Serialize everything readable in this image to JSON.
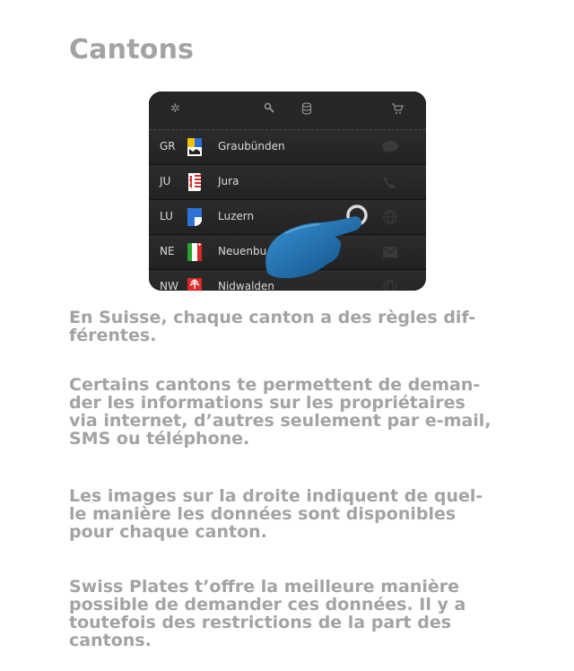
{
  "page": {
    "title": "Cantons"
  },
  "toolbar": {
    "icons": [
      "settings-icon",
      "search-icon",
      "database-icon",
      "cart-icon"
    ]
  },
  "cantons": [
    {
      "code": "GR",
      "name": "Graubünden",
      "contact": "chat-icon"
    },
    {
      "code": "JU",
      "name": "Jura",
      "contact": "phone-icon"
    },
    {
      "code": "LU",
      "name": "Luzern",
      "contact": "globe-icon"
    },
    {
      "code": "NE",
      "name": "Neuenbu",
      "contact": "mail-icon"
    },
    {
      "code": "NW",
      "name": "Nidwalden",
      "contact": "globe-icon"
    }
  ],
  "paragraphs": [
    "En Suisse, chaque canton a des règles dif-\nférentes.",
    "Certains cantons te permettent de deman-\nder les informations sur les propriétaires\nvia internet, d’autres seulement par e-mail,\nSMS ou téléphone.",
    "Les images sur la droite indiquent de quel-\nle manière les données sont disponibles\npour chaque canton.",
    "Swiss Plates t’offre la meilleure manière\npossible de demander ces données. Il y a\ntoutefois des restrictions de la part des\ncantons."
  ],
  "colors": {
    "text": "#a3a3a3",
    "hand": "#1a6fb0"
  }
}
